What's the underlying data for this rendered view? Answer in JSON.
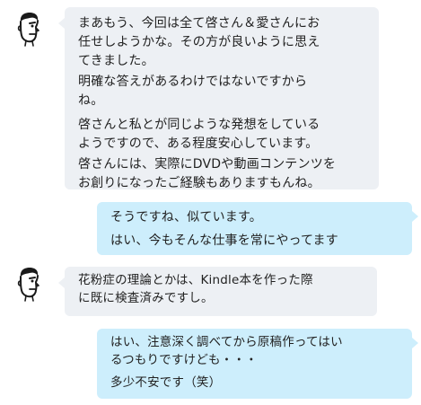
{
  "chat": {
    "messages": [
      {
        "side": "left",
        "paragraphs": [
          "まあもう、今回は全て啓さん＆愛さんにお\n任せしようかな。その方が良いように思え\nてきました。",
          "明確な答えがあるわけではないですから\nね。",
          "啓さんと私とが同じような発想をしている\nようですので、ある程度安心しています。",
          "啓さんには、実際にDVDや動画コンテンツを\nお創りになったご経験もありますもんね。"
        ]
      },
      {
        "side": "right",
        "paragraphs": [
          "そうですね、似ています。",
          "はい、今もそんな仕事を常にやってます"
        ]
      },
      {
        "side": "left",
        "paragraphs": [
          "花粉症の理論とかは、Kindle本を作った際\nに既に検査済みですし。"
        ]
      },
      {
        "side": "right",
        "paragraphs": [
          "はい、注意深く調べてから原稿作ってはい\nるつもりですけども・・・",
          "多少不安です（笑）"
        ]
      }
    ]
  },
  "colors": {
    "left_bubble": "#edf0f4",
    "right_bubble": "#cdeefc",
    "text": "#222222"
  },
  "icons": {
    "avatar": "line-drawn-man-face-icon"
  }
}
